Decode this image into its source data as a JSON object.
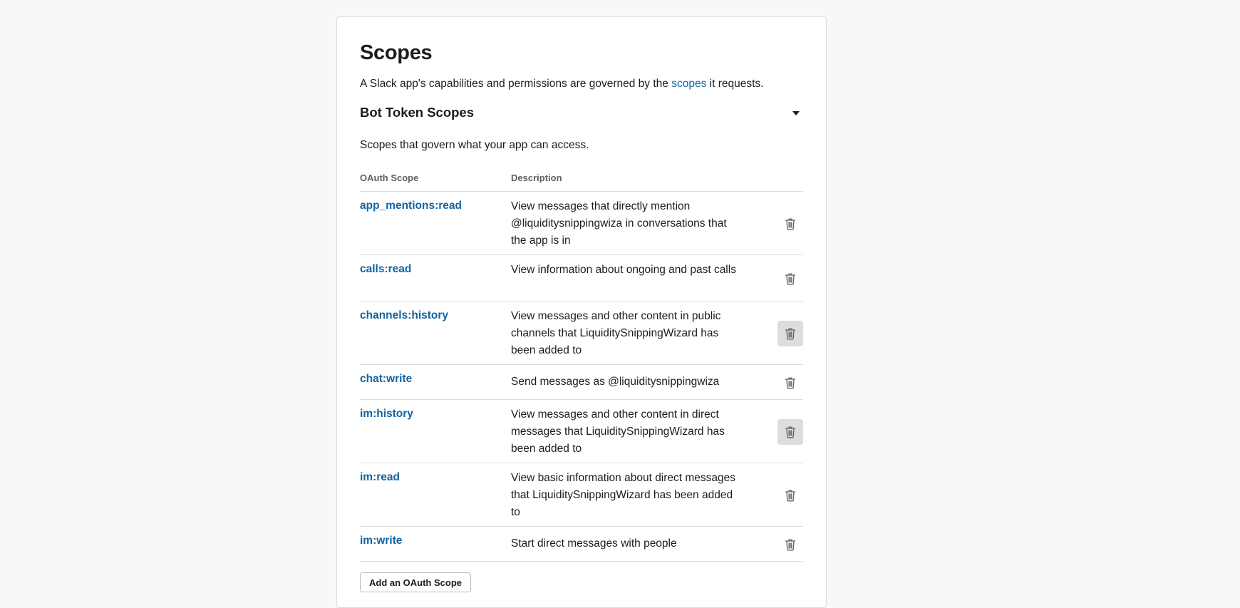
{
  "header": {
    "title": "Scopes",
    "intro_before": "A Slack app's capabilities and permissions are governed by the ",
    "intro_link": "scopes",
    "intro_after": " it requests."
  },
  "bot_section": {
    "title": "Bot Token Scopes",
    "subtitle": "Scopes that govern what your app can access.",
    "toggle_icon": "caret-down-icon"
  },
  "table": {
    "col_scope": "OAuth Scope",
    "col_description": "Description",
    "rows": [
      {
        "scope": "app_mentions:read",
        "description": "View messages that directly mention @liquiditysnippingwiza in conversations that the app is in",
        "hovered": false
      },
      {
        "scope": "calls:read",
        "description": "View information about ongoing and past calls",
        "hovered": false
      },
      {
        "scope": "channels:history",
        "description": "View messages and other content in public channels that LiquiditySnippingWizard has been added to",
        "hovered": true
      },
      {
        "scope": "chat:write",
        "description": "Send messages as @liquiditysnippingwiza",
        "hovered": false
      },
      {
        "scope": "im:history",
        "description": "View messages and other content in direct messages that LiquiditySnippingWizard has been added to",
        "hovered": true
      },
      {
        "scope": "im:read",
        "description": "View basic information about direct messages that LiquiditySnippingWizard has been added to",
        "hovered": false
      },
      {
        "scope": "im:write",
        "description": "Start direct messages with people",
        "hovered": false
      }
    ],
    "delete_icon": "trash-icon"
  },
  "add_button": {
    "label": "Add an OAuth Scope"
  },
  "colors": {
    "link": "#1264a3",
    "text": "#1d1c1d",
    "muted": "#616061",
    "border": "#dddddd",
    "hover_bg": "#dddddd"
  }
}
